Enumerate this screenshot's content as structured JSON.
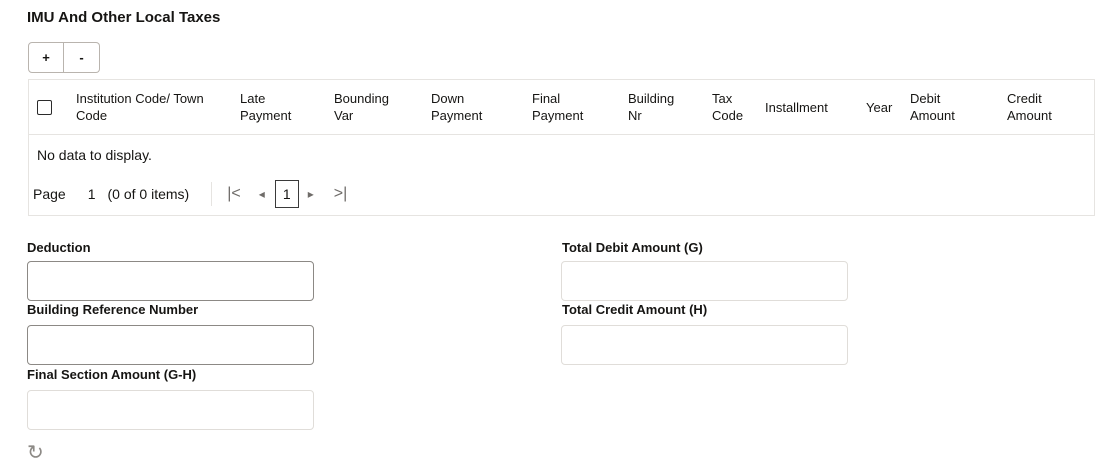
{
  "section": {
    "title": "IMU And Other Local Taxes"
  },
  "toolbar": {
    "add_label": "+",
    "remove_label": "-"
  },
  "table": {
    "columns": [
      [
        "Institution Code/ Town",
        "Code"
      ],
      [
        "Late",
        "Payment"
      ],
      [
        "Bounding",
        "Var"
      ],
      [
        "Down",
        "Payment"
      ],
      [
        "Final",
        "Payment"
      ],
      [
        "Building",
        "Nr"
      ],
      [
        "Tax",
        "Code"
      ],
      [
        "Installment"
      ],
      [
        "Year"
      ],
      [
        "Debit",
        "Amount"
      ],
      [
        "Credit",
        "Amount"
      ]
    ],
    "empty_text": "No data to display."
  },
  "pager": {
    "page_label": "Page",
    "page_number": "1",
    "items_text": "(0 of 0 items)",
    "current_page": "1"
  },
  "form": {
    "deduction": {
      "label": "Deduction",
      "value": ""
    },
    "building_ref": {
      "label": "Building Reference Number",
      "value": ""
    },
    "final_section_amount": {
      "label": "Final Section Amount (G-H)",
      "value": ""
    },
    "total_debit": {
      "label": "Total Debit Amount (G)",
      "value": ""
    },
    "total_credit": {
      "label": "Total Credit Amount (H)",
      "value": ""
    }
  },
  "icons": {
    "first_page": "|<",
    "prev_page": "◂",
    "next_page": "▸",
    "last_page": ">|",
    "refresh": "↻"
  }
}
